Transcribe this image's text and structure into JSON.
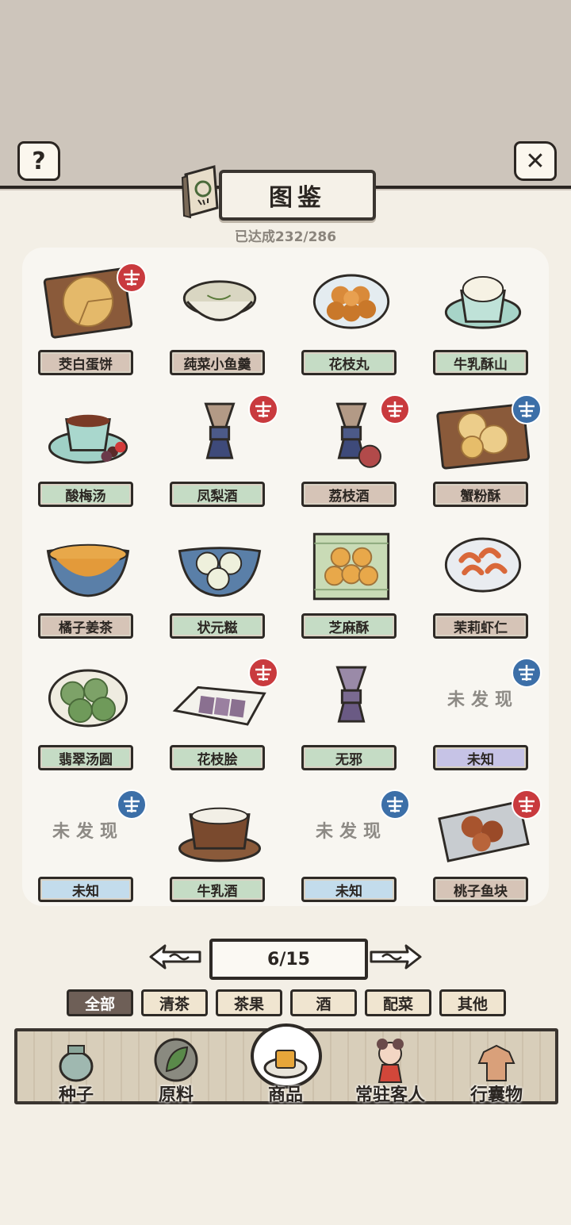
{
  "header": {
    "help_icon": "question-mark-icon",
    "close_icon": "close-x-icon",
    "title": "图鉴",
    "progress": "已达成232/286"
  },
  "grid": {
    "rows": [
      [
        {
          "label": "茭白蛋饼",
          "discovered": true,
          "seal": "red",
          "art": "egg-pancake",
          "label_color": "#d6c4b7"
        },
        {
          "label": "莼菜小鱼羹",
          "discovered": true,
          "seal": "",
          "art": "fish-soup",
          "label_color": "#d6c4b7"
        },
        {
          "label": "花枝丸",
          "discovered": true,
          "seal": "",
          "art": "squid-balls",
          "label_color": "#c5dcc5"
        },
        {
          "label": "牛乳酥山",
          "discovered": true,
          "seal": "",
          "art": "milk-ice",
          "label_color": "#c5dcc5"
        }
      ],
      [
        {
          "label": "酸梅汤",
          "discovered": true,
          "seal": "",
          "art": "plum-drink",
          "label_color": "#c5dcc5"
        },
        {
          "label": "凤梨酒",
          "discovered": true,
          "seal": "red",
          "art": "wine-vessel",
          "label_color": "#c5dcc5"
        },
        {
          "label": "荔枝酒",
          "discovered": true,
          "seal": "red",
          "art": "wine-vessel-lychee",
          "label_color": "#d6c4b7"
        },
        {
          "label": "蟹粉酥",
          "discovered": true,
          "seal": "blue",
          "art": "crab-pastry",
          "label_color": "#d6c4b7"
        }
      ],
      [
        {
          "label": "橘子姜茶",
          "discovered": true,
          "seal": "",
          "art": "orange-tea",
          "label_color": "#d6c4b7"
        },
        {
          "label": "状元糍",
          "discovered": true,
          "seal": "",
          "art": "rice-balls",
          "label_color": "#c5dcc5"
        },
        {
          "label": "芝麻酥",
          "discovered": true,
          "seal": "",
          "art": "sesame-pastry",
          "label_color": "#c5dcc5"
        },
        {
          "label": "茉莉虾仁",
          "discovered": true,
          "seal": "",
          "art": "jasmine-shrimp",
          "label_color": "#d6c4b7"
        }
      ],
      [
        {
          "label": "翡翠汤圆",
          "discovered": true,
          "seal": "",
          "art": "green-dumplings",
          "label_color": "#c5dcc5"
        },
        {
          "label": "花枝脍",
          "discovered": true,
          "seal": "red",
          "art": "squid-slices",
          "label_color": "#c5dcc5"
        },
        {
          "label": "无邪",
          "discovered": true,
          "seal": "",
          "art": "wine-vessel-purple",
          "label_color": "#c5dcc5"
        },
        {
          "label": "未知",
          "discovered": false,
          "seal": "blue",
          "art": "",
          "label_color": "#c6c3e6",
          "placeholder": "未发现"
        }
      ],
      [
        {
          "label": "未知",
          "discovered": false,
          "seal": "blue",
          "art": "",
          "label_color": "#c3dcec",
          "placeholder": "未发现"
        },
        {
          "label": "牛乳酒",
          "discovered": true,
          "seal": "",
          "art": "milk-wine",
          "label_color": "#c5dcc5"
        },
        {
          "label": "未知",
          "discovered": false,
          "seal": "blue",
          "art": "",
          "label_color": "#c3dcec",
          "placeholder": "未发现"
        },
        {
          "label": "桃子鱼块",
          "discovered": true,
          "seal": "red",
          "art": "peach-fish",
          "label_color": "#d6c4b7"
        }
      ]
    ]
  },
  "pager": {
    "text": "6/15",
    "prev_icon": "left-arrow-icon",
    "next_icon": "right-arrow-icon"
  },
  "filters": {
    "tabs": [
      "全部",
      "清茶",
      "茶果",
      "酒",
      "配菜",
      "其他"
    ],
    "active_index": 0
  },
  "bottom_nav": {
    "items": [
      {
        "label": "种子",
        "icon": "seed-jar-icon"
      },
      {
        "label": "原料",
        "icon": "tea-leaf-icon"
      },
      {
        "label": "商品",
        "icon": "pastry-plate-icon",
        "active": true
      },
      {
        "label": "常驻客人",
        "icon": "guest-girl-icon"
      },
      {
        "label": "行囊物",
        "icon": "robe-icon"
      }
    ]
  },
  "colors": {
    "top_band": "#cdc5bb",
    "page_bg": "#f3efe6",
    "panel_bg": "#f8f6f1",
    "seal_red": "#c93a3e",
    "seal_blue": "#3c6fa8",
    "ink": "#2b2622"
  }
}
